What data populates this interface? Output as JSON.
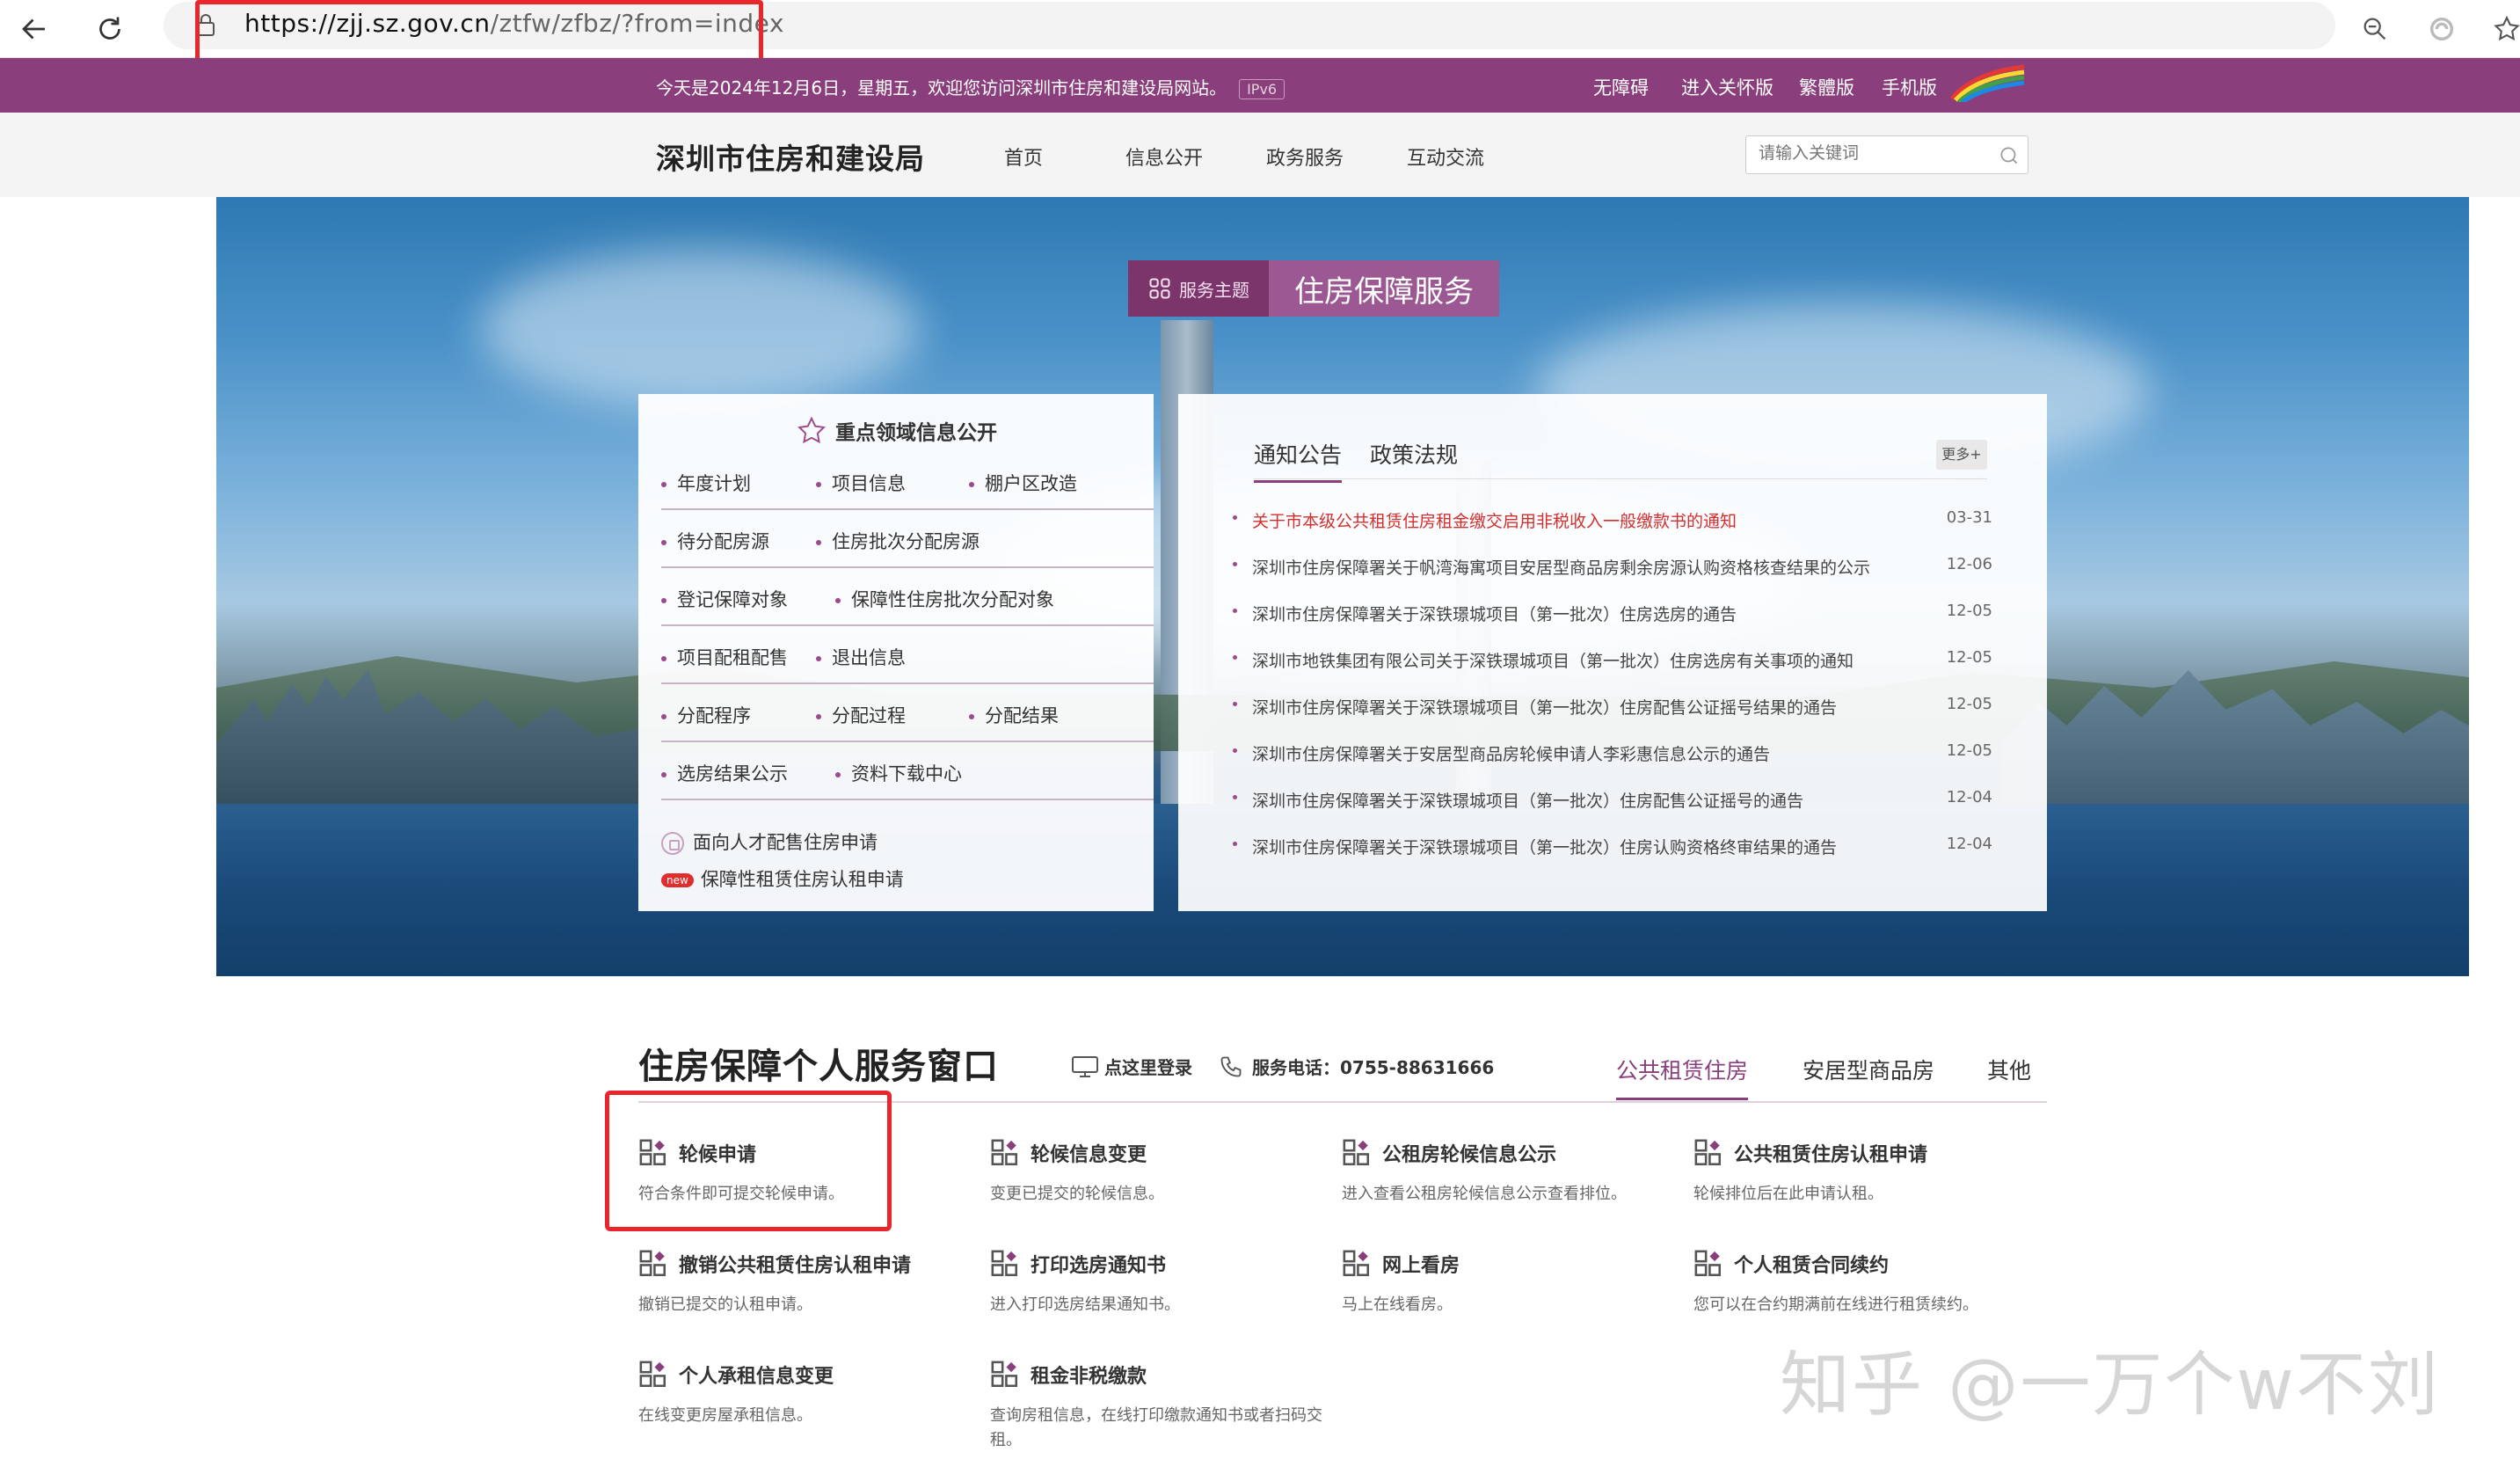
{
  "browser": {
    "url_host": "https://zjj.sz.gov.cn",
    "url_rest": "/ztfw/zfbz/?from=index"
  },
  "topbar": {
    "today": "今天是2024年12月6日，星期五，欢迎您访问深圳市住房和建设局网站。",
    "ipv6": "IPv6",
    "links": [
      "无障碍",
      "进入关怀版",
      "繁體版",
      "手机版"
    ]
  },
  "header": {
    "site_title": "深圳市住房和建设局",
    "nav": [
      "首页",
      "信息公开",
      "政务服务",
      "互动交流"
    ],
    "search_placeholder": "请输入关键词"
  },
  "hero": {
    "badge_left": "服务主题",
    "badge_right": "住房保障服务"
  },
  "left_panel": {
    "title": "重点领域信息公开",
    "rows": [
      [
        "年度计划",
        "项目信息",
        "棚户区改造"
      ],
      [
        "待分配房源",
        "住房批次分配房源"
      ],
      [
        "登记保障对象",
        "保障性住房批次分配对象"
      ],
      [
        "项目配租配售",
        "退出信息"
      ],
      [
        "分配程序",
        "分配过程",
        "分配结果"
      ],
      [
        "选房结果公示",
        "资料下载中心"
      ]
    ],
    "special1": "面向人才配售住房申请",
    "special2_badge": "new",
    "special2": "保障性租赁住房认租申请"
  },
  "right_panel": {
    "tabs": [
      "通知公告",
      "政策法规"
    ],
    "more": "更多+",
    "news": [
      {
        "title": "关于市本级公共租赁住房租金缴交启用非税收入一般缴款书的通知",
        "date": "03-31",
        "hot": true
      },
      {
        "title": "深圳市住房保障署关于帆湾海寓项目安居型商品房剩余房源认购资格核查结果的公示",
        "date": "12-06"
      },
      {
        "title": "深圳市住房保障署关于深铁璟城项目（第一批次）住房选房的通告",
        "date": "12-05"
      },
      {
        "title": "深圳市地铁集团有限公司关于深铁璟城项目（第一批次）住房选房有关事项的通知",
        "date": "12-05"
      },
      {
        "title": "深圳市住房保障署关于深铁璟城项目（第一批次）住房配售公证摇号结果的通告",
        "date": "12-05"
      },
      {
        "title": "深圳市住房保障署关于安居型商品房轮候申请人李彩惠信息公示的通告",
        "date": "12-05"
      },
      {
        "title": "深圳市住房保障署关于深铁璟城项目（第一批次）住房配售公证摇号的通告",
        "date": "12-04"
      },
      {
        "title": "深圳市住房保障署关于深铁璟城项目（第一批次）住房认购资格终审结果的通告",
        "date": "12-04"
      }
    ]
  },
  "services": {
    "title": "住房保障个人服务窗口",
    "login": "点这里登录",
    "phone": "服务电话：0755-88631666",
    "tabs": [
      "公共租赁住房",
      "安居型商品房",
      "其他"
    ],
    "items": [
      {
        "name": "轮候申请",
        "desc": "符合条件即可提交轮候申请。"
      },
      {
        "name": "轮候信息变更",
        "desc": "变更已提交的轮候信息。"
      },
      {
        "name": "公租房轮候信息公示",
        "desc": "进入查看公租房轮候信息公示查看排位。"
      },
      {
        "name": "公共租赁住房认租申请",
        "desc": "轮候排位后在此申请认租。"
      },
      {
        "name": "撤销公共租赁住房认租申请",
        "desc": "撤销已提交的认租申请。"
      },
      {
        "name": "打印选房通知书",
        "desc": "进入打印选房结果通知书。"
      },
      {
        "name": "网上看房",
        "desc": "马上在线看房。"
      },
      {
        "name": "个人租赁合同续约",
        "desc": "您可以在合约期满前在线进行租赁续约。"
      },
      {
        "name": "个人承租信息变更",
        "desc": "在线变更房屋承租信息。"
      },
      {
        "name": "租金非税缴款",
        "desc": "查询房租信息，在线打印缴款通知书或者扫码交租。"
      }
    ]
  },
  "watermark": "知乎 @一万个w不刘"
}
